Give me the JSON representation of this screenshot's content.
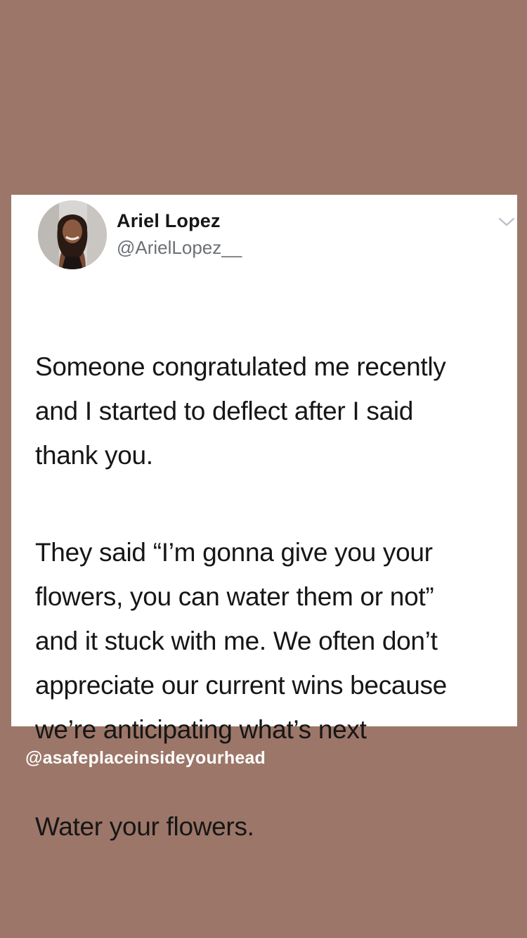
{
  "tweet": {
    "author_name": "Ariel Lopez",
    "author_handle": "@ArielLopez__",
    "paragraphs": [
      "Someone congratulated me recently\nand I started to deflect after I said\nthank you.",
      "They said “I’m gonna give you your\nflowers, you can water them or not”\nand it stuck with me. We often don’t\nappreciate our current wins because\nwe’re anticipating what’s next",
      "Water your flowers."
    ]
  },
  "credit": "@asafeplaceinsideyourhead",
  "colors": {
    "background": "#9c7668",
    "card": "#ffffff",
    "text": "#161616",
    "handle": "#6c7176"
  },
  "icons": {
    "menu": "chevron-down-icon"
  }
}
